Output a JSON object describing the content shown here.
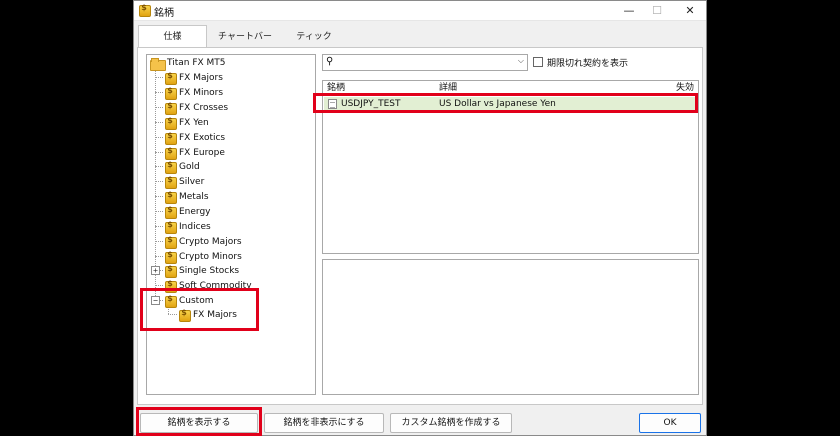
{
  "window": {
    "title": "銘柄"
  },
  "tabs": [
    {
      "label": "仕様"
    },
    {
      "label": "チャートバー"
    },
    {
      "label": "ティック"
    }
  ],
  "tree": {
    "root": "Titan FX MT5",
    "items": [
      {
        "label": "FX Majors"
      },
      {
        "label": "FX Minors"
      },
      {
        "label": "FX Crosses"
      },
      {
        "label": "FX Yen"
      },
      {
        "label": "FX Exotics"
      },
      {
        "label": "FX Europe"
      },
      {
        "label": "Gold"
      },
      {
        "label": "Silver"
      },
      {
        "label": "Metals"
      },
      {
        "label": "Energy"
      },
      {
        "label": "Indices"
      },
      {
        "label": "Crypto Majors"
      },
      {
        "label": "Crypto Minors"
      },
      {
        "label": "Single Stocks"
      },
      {
        "label": "Soft Commodity"
      },
      {
        "label": "Custom"
      }
    ],
    "custom_child": "FX Majors"
  },
  "search": {
    "value": "",
    "placeholder": ""
  },
  "expired_checkbox_label": "期限切れ契約を表示",
  "symbol_table": {
    "columns": [
      "銘柄",
      "詳細",
      "失効"
    ],
    "rows": [
      {
        "symbol": "USDJPY_TEST",
        "description": "US Dollar vs Japanese Yen",
        "expiration": ""
      }
    ]
  },
  "buttons": {
    "show": "銘柄を表示する",
    "hide": "銘柄を非表示にする",
    "create_custom": "カスタム銘柄を作成する",
    "ok": "OK"
  },
  "icons": {
    "search": "search-icon",
    "dropdown": "chevron-down-icon",
    "symbol_group": "dollar-coin-icon",
    "root_folder": "folder-icon",
    "symbol": "document-icon"
  },
  "colors": {
    "highlight": "#e1001a",
    "selected_row": "#e2efd3",
    "ok_border": "#1a73e8"
  }
}
